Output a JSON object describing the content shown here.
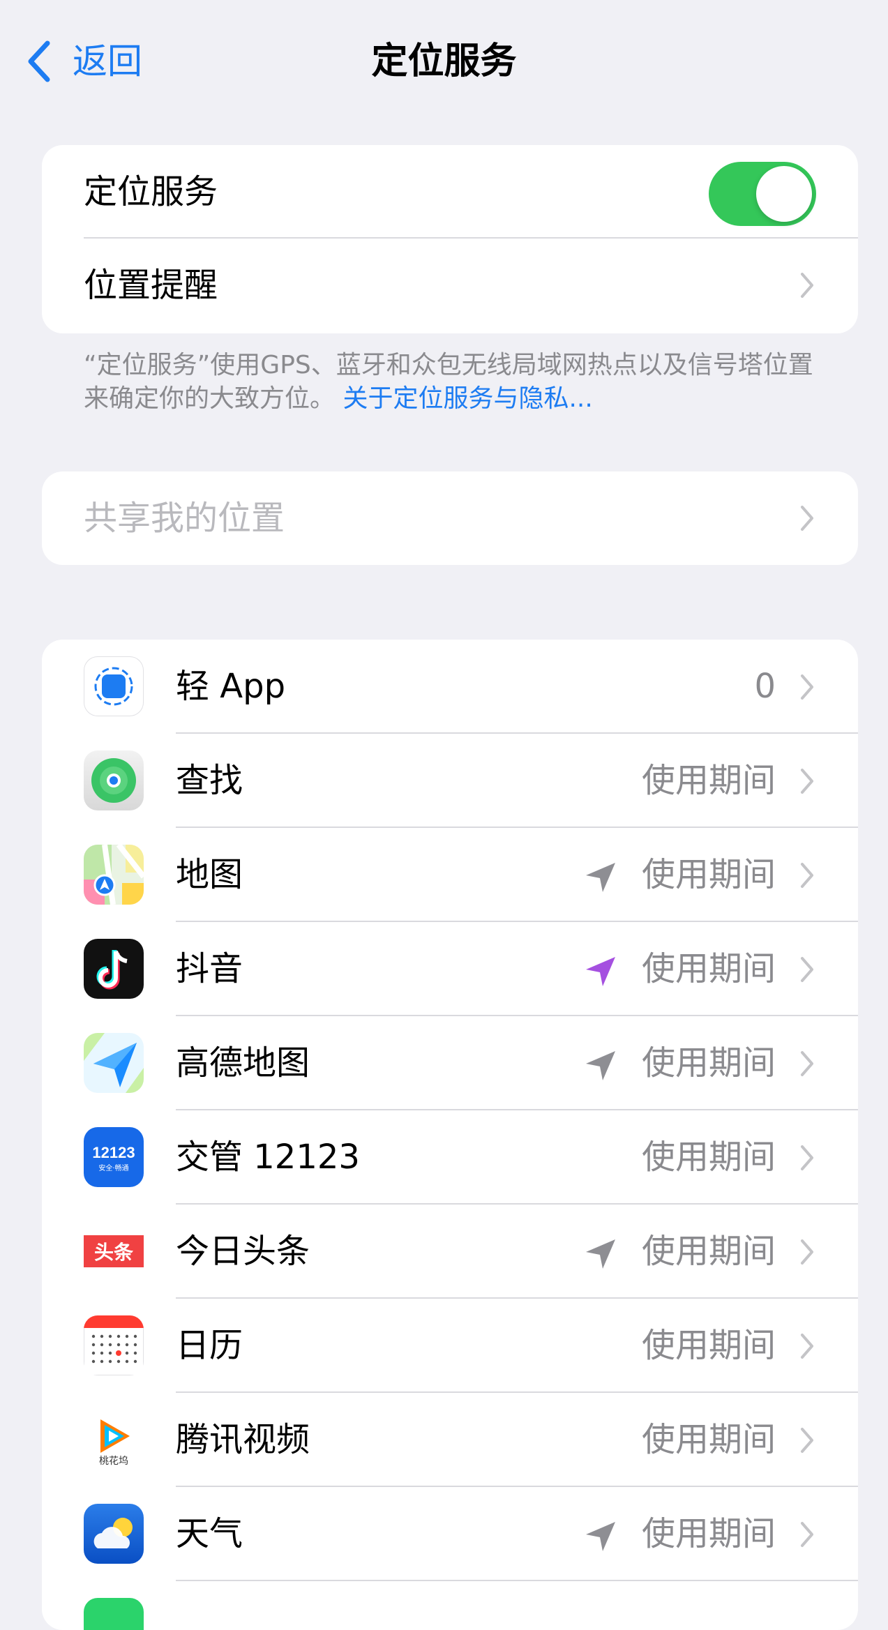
{
  "nav": {
    "back_label": "返回",
    "title": "定位服务"
  },
  "settings": {
    "location_services_label": "定位服务",
    "location_services_on": true,
    "location_alerts_label": "位置提醒"
  },
  "footer": {
    "text": "“定位服务”使用GPS、蓝牙和众包无线局域网热点以及信号塔位置来确定你的大致方位。",
    "link": "关于定位服务与隐私..."
  },
  "share": {
    "label": "共享我的位置"
  },
  "apps": [
    {
      "name": "轻 App",
      "status": "0",
      "icon": "app-clip-icon",
      "arrow": null
    },
    {
      "name": "查找",
      "status": "使用期间",
      "icon": "find-my-icon",
      "arrow": null
    },
    {
      "name": "地图",
      "status": "使用期间",
      "icon": "maps-icon",
      "arrow": "gray"
    },
    {
      "name": "抖音",
      "status": "使用期间",
      "icon": "douyin-icon",
      "arrow": "purple"
    },
    {
      "name": "高德地图",
      "status": "使用期间",
      "icon": "amap-icon",
      "arrow": "gray"
    },
    {
      "name": "交管 12123",
      "status": "使用期间",
      "icon": "traffic-12123-icon",
      "arrow": null
    },
    {
      "name": "今日头条",
      "status": "使用期间",
      "icon": "toutiao-icon",
      "arrow": "gray"
    },
    {
      "name": "日历",
      "status": "使用期间",
      "icon": "calendar-icon",
      "arrow": null
    },
    {
      "name": "腾讯视频",
      "status": "使用期间",
      "icon": "tencent-video-icon",
      "arrow": null
    },
    {
      "name": "天气",
      "status": "使用期间",
      "icon": "weather-icon",
      "arrow": "gray"
    }
  ],
  "icon_text": {
    "traffic_top": "12123",
    "traffic_bottom": "安全·畅通",
    "toutiao": "头条",
    "tencent_badge": "桃花坞"
  },
  "colors": {
    "accent": "#1d7cf2",
    "toggle_on": "#34c759",
    "arrow_gray": "#8e8e93",
    "arrow_purple": "#a550e0"
  }
}
